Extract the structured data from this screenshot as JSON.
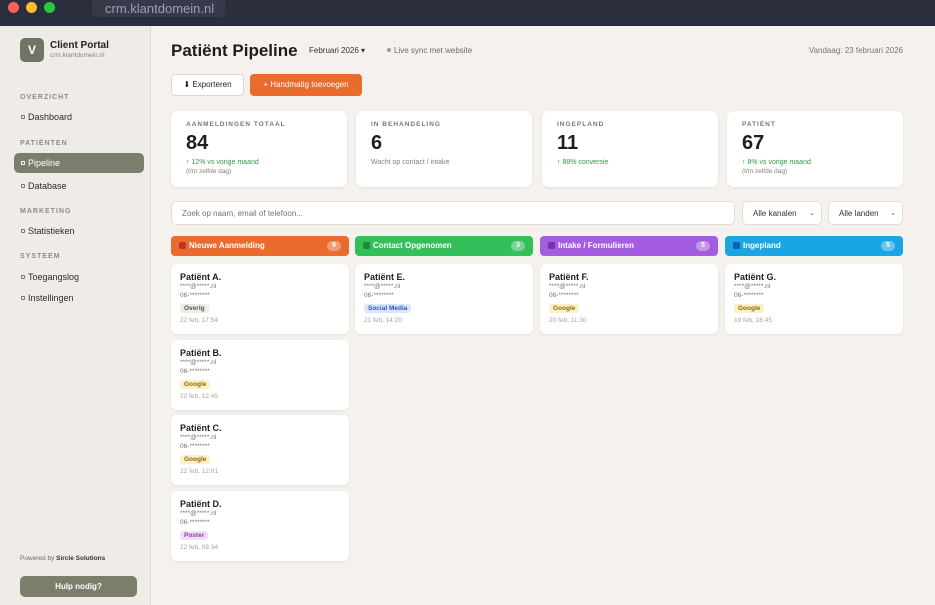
{
  "window": {
    "url": "crm.klantdomein.nl"
  },
  "sidebar": {
    "brand": {
      "logo": "V",
      "name": "Client Portal",
      "domain": "crm.klantdomein.nl"
    },
    "sections": [
      {
        "label": "OVERZICHT",
        "items": [
          {
            "label": "Dashboard"
          }
        ]
      },
      {
        "label": "PATIËNTEN",
        "items": [
          {
            "label": "Pipeline",
            "active": true
          },
          {
            "label": "Database"
          }
        ]
      },
      {
        "label": "MARKETING",
        "items": [
          {
            "label": "Statistieken"
          }
        ]
      },
      {
        "label": "SYSTEEM",
        "items": [
          {
            "label": "Toegangslog"
          },
          {
            "label": "Instellingen"
          }
        ]
      }
    ],
    "powered_prefix": "Powered by",
    "powered_by": "Sircle Solutions",
    "help_label": "Hulp nodig?"
  },
  "header": {
    "title": "Patiënt Pipeline",
    "month": "Februari 2026",
    "live_sync": "Live sync met website",
    "today": "Vandaag: 23 februari 2026"
  },
  "actions": {
    "export_label": "⬇ Exporteren",
    "add_label": "+ Handmatig toevoegen"
  },
  "stats": [
    {
      "label": "AANMELDINGEN TOTAAL",
      "value": "84",
      "sub": "↑ 12% vs vorige maand",
      "sub_style": "green",
      "sub2": "(t/m zelfde dag)"
    },
    {
      "label": "IN BEHANDELING",
      "value": "6",
      "sub": "Wacht op contact / intake",
      "sub_style": "grey",
      "sub2": ""
    },
    {
      "label": "INGEPLAND",
      "value": "11",
      "sub": "↑ 88% conversie",
      "sub_style": "green",
      "sub2": ""
    },
    {
      "label": "PATIËNT",
      "value": "67",
      "sub": "↑ 8% vs vorige maand",
      "sub_style": "green",
      "sub2": "(t/m zelfde dag)"
    }
  ],
  "search": {
    "placeholder": "Zoek op naam, email of telefoon..."
  },
  "filters": {
    "channels": "Alle kanalen",
    "countries": "Alle landen"
  },
  "colors": {
    "accent": "#7b7e6b",
    "orange": "#ea6b2e",
    "green": "#34bf5a",
    "purple": "#a45ce0",
    "blue": "#1aa6e3"
  },
  "columns": [
    {
      "title": "Nieuwe Aanmelding",
      "count": "9",
      "color": "#ea6b2e",
      "dot": "#c8302a",
      "cards": [
        {
          "name": "Patiënt A.",
          "email": "****@*****.nl",
          "phone": "06-********",
          "tag": "Overig",
          "tag_style": "overig",
          "date": "22 feb, 17:54"
        },
        {
          "name": "Patiënt B.",
          "email": "****@*****.nl",
          "phone": "06-********",
          "tag": "Google",
          "tag_style": "google",
          "date": "22 feb, 12:45"
        },
        {
          "name": "Patiënt C.",
          "email": "****@*****.nl",
          "phone": "06-********",
          "tag": "Google",
          "tag_style": "google",
          "date": "22 feb, 12:01"
        },
        {
          "name": "Patiënt D.",
          "email": "****@*****.nl",
          "phone": "06-********",
          "tag": "Poster",
          "tag_style": "poster",
          "date": "22 feb, 09:34"
        }
      ]
    },
    {
      "title": "Contact Opgenomen",
      "count": "3",
      "color": "#34bf5a",
      "dot": "#1d8a36",
      "cards": [
        {
          "name": "Patiënt E.",
          "email": "****@*****.nl",
          "phone": "06-********",
          "tag": "Social Media",
          "tag_style": "social",
          "date": "21 feb, 14:20"
        }
      ]
    },
    {
      "title": "Intake / Formulieren",
      "count": "5",
      "color": "#a45ce0",
      "dot": "#7a2fb8",
      "cards": [
        {
          "name": "Patiënt F.",
          "email": "****@*****.nl",
          "phone": "06-********",
          "tag": "Google",
          "tag_style": "google",
          "date": "20 feb, 11:30"
        }
      ]
    },
    {
      "title": "Ingepland",
      "count": "5",
      "color": "#1aa6e3",
      "dot": "#0d5fb3",
      "cards": [
        {
          "name": "Patiënt G.",
          "email": "****@*****.nl",
          "phone": "06-********",
          "tag": "Google",
          "tag_style": "google",
          "date": "19 feb, 16:45"
        }
      ]
    }
  ]
}
